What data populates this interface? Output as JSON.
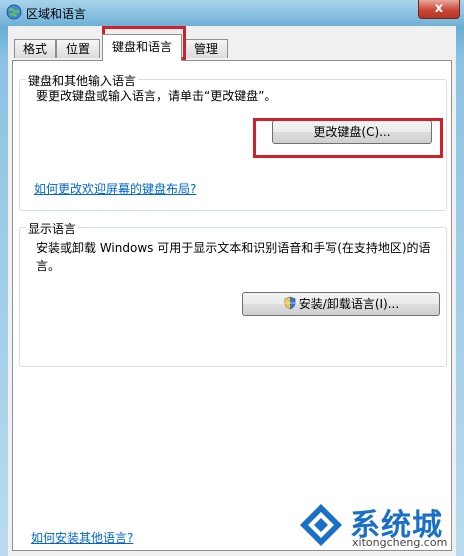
{
  "window": {
    "title": "区域和语言",
    "close_label": "x"
  },
  "tabs": [
    {
      "label": "格式"
    },
    {
      "label": "位置"
    },
    {
      "label": "键盘和语言",
      "active": true
    },
    {
      "label": "管理"
    }
  ],
  "keyboard_group": {
    "title": "键盘和其他输入语言",
    "description": "要更改键盘或输入语言，请单击“更改键盘”。",
    "change_button": "更改键盘(C)...",
    "help_link": "如何更改欢迎屏幕的键盘布局?"
  },
  "display_group": {
    "title": "显示语言",
    "description_line1": "安装或卸载 Windows 可用于显示文本和识别语音和手写(在支持地区)的语",
    "description_line2": "言。",
    "install_button": "安装/卸载语言(I)..."
  },
  "footer_link": "如何安装其他语言?",
  "watermark": {
    "name": "系统城",
    "url": "xitongcheng.com"
  },
  "colors": {
    "highlight": "#d0202a",
    "link": "#0066cc",
    "watermark": "#1a6fc6"
  }
}
